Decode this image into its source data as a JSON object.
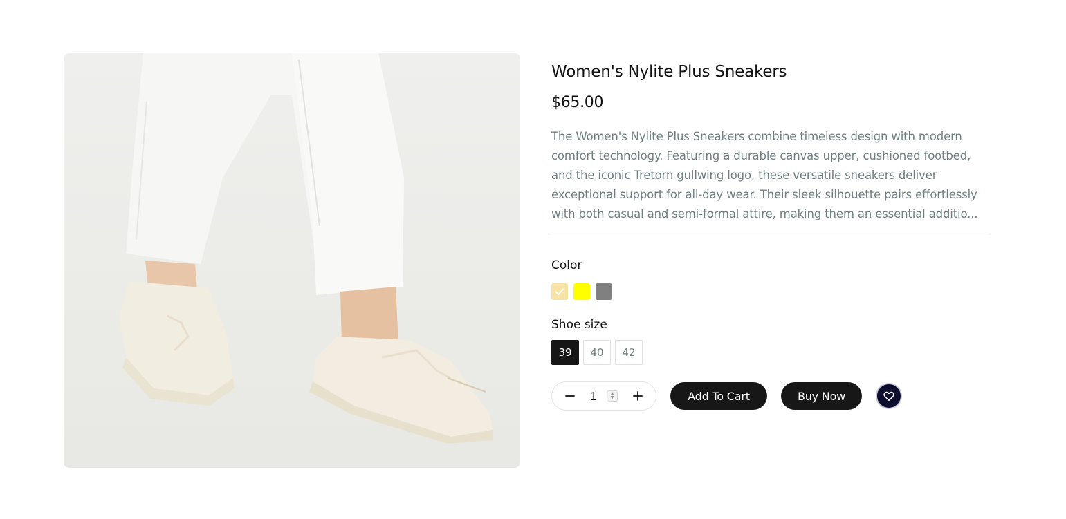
{
  "product": {
    "image_alt": "Women's Nylite Plus Sneakers",
    "title": "Women's Nylite Plus Sneakers",
    "price": "$65.00",
    "description_lines": [
      "The Women's Nylite Plus Sneakers combine timeless design with modern",
      "comfort technology. Featuring a durable canvas upper, cushioned footbed,",
      "and the iconic Tretorn gullwing logo, these versatile sneakers deliver",
      "exceptional support for all-day wear. Their sleek silhouette pairs effortlessly",
      "with both casual and semi-formal attire, making them an essential additio..."
    ]
  },
  "color": {
    "label": "Color",
    "swatches": [
      {
        "color": "#f7e3a6",
        "selected": true
      },
      {
        "color": "#ffff00",
        "selected": false
      },
      {
        "color": "#808080",
        "selected": false
      }
    ]
  },
  "size": {
    "label": "Shoe size",
    "options": [
      "39",
      "40",
      "42"
    ],
    "selected": "39"
  },
  "quantity": {
    "value": "1",
    "minus_icon": "minus-icon",
    "plus_icon": "plus-icon"
  },
  "actions": {
    "add_to_cart": "Add To Cart",
    "buy_now": "Buy Now",
    "wishlist_icon": "heart-icon"
  },
  "colors": {
    "dark": "#171717",
    "muted_text": "#6f7f7f",
    "wishlist_bg": "#0e0e2e"
  }
}
